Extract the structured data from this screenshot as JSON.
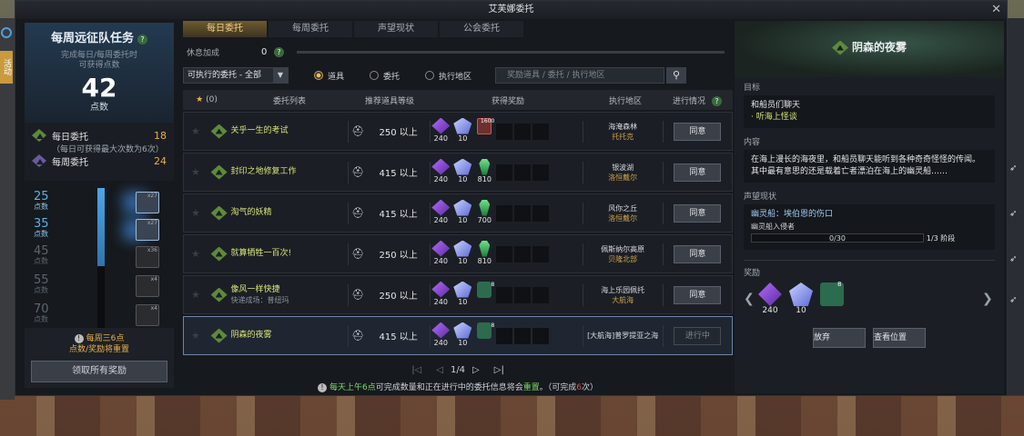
{
  "window": {
    "title": "艾芙娜委托"
  },
  "side": {
    "left_tab": "活动"
  },
  "left": {
    "title": "每周远征队任务",
    "help": "?",
    "subtitle": "完成每日/每周委托时\n可获得点数",
    "points": "42",
    "points_unit": "点数",
    "daily_label": "每日委托",
    "daily_value": "18",
    "daily_note": "（每日可获得最大次数为6次）",
    "weekly_label": "每周委托",
    "weekly_value": "24",
    "tiers": [
      {
        "value": "25",
        "label": "点数",
        "reached": true,
        "count": "x27"
      },
      {
        "value": "35",
        "label": "点数",
        "reached": true,
        "count": "x27"
      },
      {
        "value": "45",
        "label": "点数",
        "reached": false,
        "count": "x36"
      },
      {
        "value": "55",
        "label": "点数",
        "reached": false,
        "count": "x4"
      },
      {
        "value": "70",
        "label": "点数",
        "reached": false,
        "count": "x4"
      }
    ],
    "progress_fraction": 0.56,
    "reset_line1": "每周三6点",
    "reset_line2": "点数/奖励将重置",
    "claim_button": "领取所有奖励"
  },
  "center": {
    "tabs": [
      "每日委托",
      "每周委托",
      "声望现状",
      "公会委托"
    ],
    "active_tab": 0,
    "rest_label": "休息加成",
    "rest_value": "0",
    "filter_value": "可执行的委托 - 全部",
    "radios": [
      {
        "label": "道具",
        "checked": true
      },
      {
        "label": "委托",
        "checked": false
      },
      {
        "label": "执行地区",
        "checked": false
      }
    ],
    "search_placeholder": "奖励道具 / 委托 / 执行地区",
    "headers": {
      "star_count": "(0)",
      "list": "委托列表",
      "level": "推荐道具等级",
      "reward": "获得奖励",
      "area": "执行地区",
      "status": "进行情况"
    },
    "rows": [
      {
        "name": "关乎一生的考试",
        "sub": "",
        "level": "250 以上",
        "rewards": [
          {
            "kind": "purple",
            "qty": "240"
          },
          {
            "kind": "crystal",
            "qty": "10"
          },
          {
            "kind": "redbox",
            "qty": "",
            "count": "1600"
          }
        ],
        "area": "海淹森林",
        "area_sub": "托托克",
        "action": "同意",
        "in_progress": false
      },
      {
        "name": "封印之地修复工作",
        "sub": "",
        "level": "415 以上",
        "rewards": [
          {
            "kind": "purple",
            "qty": "240"
          },
          {
            "kind": "crystal",
            "qty": "10"
          },
          {
            "kind": "green",
            "qty": "810"
          }
        ],
        "area": "银波湖",
        "area_sub": "洛恒戴尔",
        "action": "同意",
        "in_progress": false
      },
      {
        "name": "淘气的妖精",
        "sub": "",
        "level": "415 以上",
        "rewards": [
          {
            "kind": "purple",
            "qty": "240"
          },
          {
            "kind": "crystal",
            "qty": "10"
          },
          {
            "kind": "green",
            "qty": "700"
          }
        ],
        "area": "风你之丘",
        "area_sub": "洛恒戴尔",
        "action": "同意",
        "in_progress": false
      },
      {
        "name": "就算牺牲一百次!",
        "sub": "",
        "level": "250 以上",
        "rewards": [
          {
            "kind": "purple",
            "qty": "240"
          },
          {
            "kind": "crystal",
            "qty": "10"
          },
          {
            "kind": "green",
            "qty": "810"
          }
        ],
        "area": "佩斯纳尔高原",
        "area_sub": "贝隆北部",
        "action": "同意",
        "in_progress": false
      },
      {
        "name": "像风一样快捷",
        "sub": "快递成场：普纽玛",
        "level": "250 以上",
        "rewards": [
          {
            "kind": "purple",
            "qty": "240"
          },
          {
            "kind": "crystal",
            "qty": "10"
          },
          {
            "kind": "sea",
            "qty": "",
            "count": "8"
          }
        ],
        "area": "海上乐园佩托",
        "area_sub": "大航海",
        "action": "同意",
        "in_progress": false
      },
      {
        "name": "阴森的夜雾",
        "sub": "",
        "level": "415 以上",
        "rewards": [
          {
            "kind": "purple",
            "qty": "240"
          },
          {
            "kind": "crystal",
            "qty": "10"
          },
          {
            "kind": "sea",
            "qty": "",
            "count": "8"
          }
        ],
        "area": "[大航海]普罗提亚之海",
        "area_sub": "",
        "action": "进行中",
        "in_progress": true
      }
    ],
    "pager": {
      "first": "|◁",
      "prev": "◁",
      "current": "1/4",
      "next": "▷",
      "last": "▷|"
    },
    "notice_pre": "每天上午6点",
    "notice_mid": "可完成数量和正在进行中的委托信息将会",
    "notice_hl": "重置",
    "notice_tail": "。（可完成",
    "notice_red": "6",
    "notice_end": "次）"
  },
  "right": {
    "title": "阴森的夜雾",
    "goal_label": "目标",
    "goal_main": "和船员们聊天",
    "goal_bullet": "· 听海上怪谈",
    "content_label": "内容",
    "content_text": "在海上漫长的海夜里，和船员聊天能听到各种奇奇怪怪的传闻。其中最有意思的还是载着亡者漂泊在海上的幽灵船……",
    "rep_label": "声望现状",
    "rep_name": "幽灵船：埃伯恩的伤口",
    "rep_sub": "幽灵船入侵者",
    "rep_progress": "0/30",
    "rep_stage": "1/3 阶段",
    "reward_label": "奖励",
    "rewards": [
      {
        "kind": "purple",
        "qty": "240"
      },
      {
        "kind": "crystal",
        "qty": "10"
      },
      {
        "kind": "sea",
        "qty": "",
        "count": "8"
      }
    ],
    "abandon_button": "放弃",
    "locate_button": "查看位置"
  },
  "colors": {
    "accent_gold": "#e8b04a",
    "quest_yellow": "#d8e478",
    "active_blue": "#5fb0e8"
  }
}
